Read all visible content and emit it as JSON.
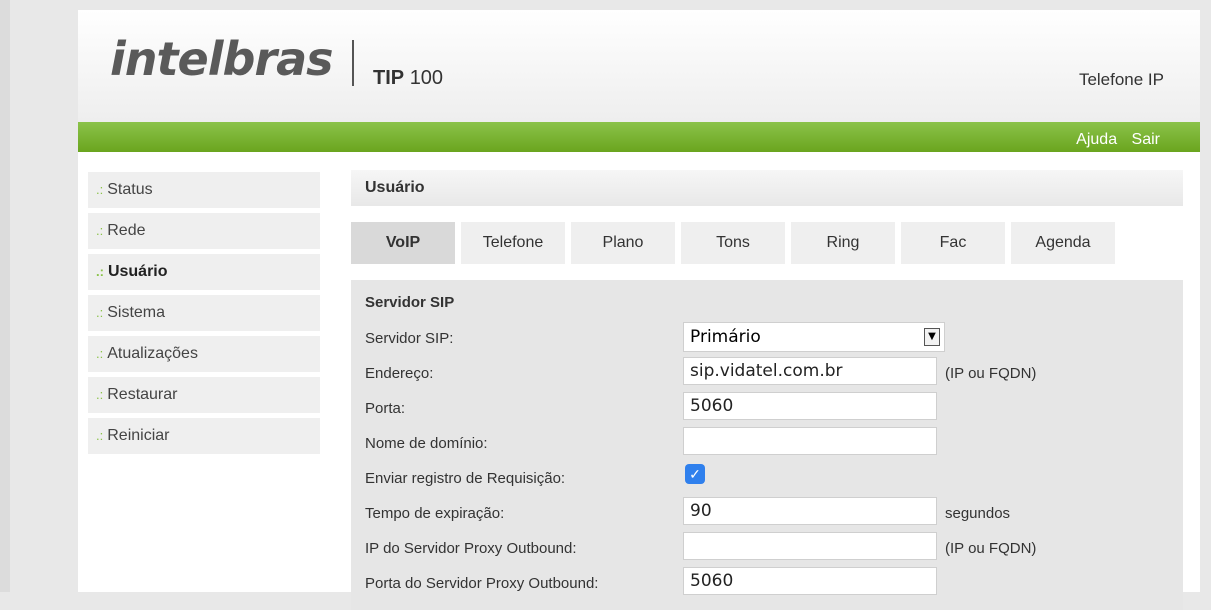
{
  "header": {
    "logo": "intelbras",
    "model_bold": "TIP",
    "model_num": "100",
    "product": "Telefone IP"
  },
  "top_links": {
    "help": "Ajuda",
    "logout": "Sair"
  },
  "sidebar": {
    "items": [
      {
        "label": "Status"
      },
      {
        "label": "Rede"
      },
      {
        "label": "Usuário"
      },
      {
        "label": "Sistema"
      },
      {
        "label": "Atualizações"
      },
      {
        "label": "Restaurar"
      },
      {
        "label": "Reiniciar"
      }
    ]
  },
  "main": {
    "title": "Usuário",
    "tabs": [
      {
        "label": "VoIP"
      },
      {
        "label": "Telefone"
      },
      {
        "label": "Plano"
      },
      {
        "label": "Tons"
      },
      {
        "label": "Ring"
      },
      {
        "label": "Fac"
      },
      {
        "label": "Agenda"
      }
    ],
    "panel_title": "Servidor SIP",
    "fields": {
      "servidor_sip": {
        "label": "Servidor SIP:",
        "value": "Primário"
      },
      "endereco": {
        "label": "Endereço:",
        "value": "sip.vidatel.com.br",
        "note": "(IP ou FQDN)"
      },
      "porta": {
        "label": "Porta:",
        "value": "5060"
      },
      "dominio": {
        "label": "Nome de domínio:",
        "value": ""
      },
      "registro": {
        "label": "Enviar registro de Requisição:",
        "checked": true,
        "glyph": "✓"
      },
      "expiracao": {
        "label": "Tempo de expiração:",
        "value": "90",
        "note": "segundos"
      },
      "proxy_ip": {
        "label": "IP do Servidor Proxy Outbound:",
        "value": "",
        "note": "(IP ou FQDN)"
      },
      "proxy_porta": {
        "label": "Porta do Servidor Proxy Outbound:",
        "value": "5060"
      }
    }
  }
}
